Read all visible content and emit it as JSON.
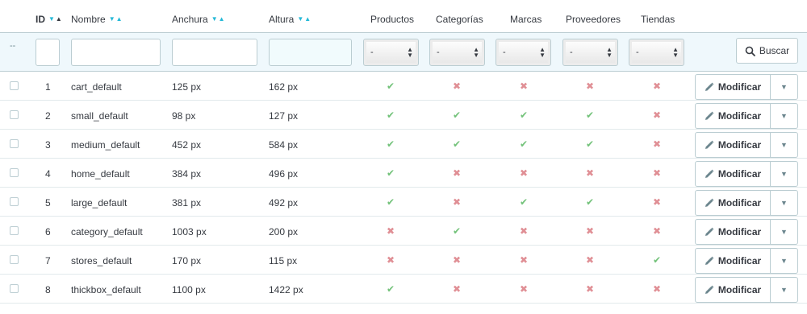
{
  "columns": {
    "id": "ID",
    "nombre": "Nombre",
    "anchura": "Anchura",
    "altura": "Altura",
    "productos": "Productos",
    "categorias": "Categorías",
    "marcas": "Marcas",
    "proveedores": "Proveedores",
    "tiendas": "Tiendas"
  },
  "filters": {
    "bulk_placeholder": "--",
    "select_value": "-",
    "search_label": "Buscar"
  },
  "rows": [
    {
      "id": "1",
      "name": "cart_default",
      "width": "125 px",
      "height": "162 px",
      "productos": true,
      "categorias": false,
      "marcas": false,
      "proveedores": false,
      "tiendas": false
    },
    {
      "id": "2",
      "name": "small_default",
      "width": "98 px",
      "height": "127 px",
      "productos": true,
      "categorias": true,
      "marcas": true,
      "proveedores": true,
      "tiendas": false
    },
    {
      "id": "3",
      "name": "medium_default",
      "width": "452 px",
      "height": "584 px",
      "productos": true,
      "categorias": true,
      "marcas": true,
      "proveedores": true,
      "tiendas": false
    },
    {
      "id": "4",
      "name": "home_default",
      "width": "384 px",
      "height": "496 px",
      "productos": true,
      "categorias": false,
      "marcas": false,
      "proveedores": false,
      "tiendas": false
    },
    {
      "id": "5",
      "name": "large_default",
      "width": "381 px",
      "height": "492 px",
      "productos": true,
      "categorias": false,
      "marcas": true,
      "proveedores": true,
      "tiendas": false
    },
    {
      "id": "6",
      "name": "category_default",
      "width": "1003 px",
      "height": "200 px",
      "productos": false,
      "categorias": true,
      "marcas": false,
      "proveedores": false,
      "tiendas": false
    },
    {
      "id": "7",
      "name": "stores_default",
      "width": "170 px",
      "height": "115 px",
      "productos": false,
      "categorias": false,
      "marcas": false,
      "proveedores": false,
      "tiendas": true
    },
    {
      "id": "8",
      "name": "thickbox_default",
      "width": "1100 px",
      "height": "1422 px",
      "productos": true,
      "categorias": false,
      "marcas": false,
      "proveedores": false,
      "tiendas": false
    }
  ],
  "row_action": {
    "edit_label": "Modificar"
  },
  "icons": {
    "check": "check-icon",
    "cross": "cross-icon",
    "pencil": "pencil-icon",
    "caret": "caret-down-icon",
    "search": "search-icon"
  },
  "colors": {
    "accent": "#25b9d7",
    "check": "#72c279",
    "cross": "#e08f95",
    "filter_bg": "#eff8fc"
  }
}
